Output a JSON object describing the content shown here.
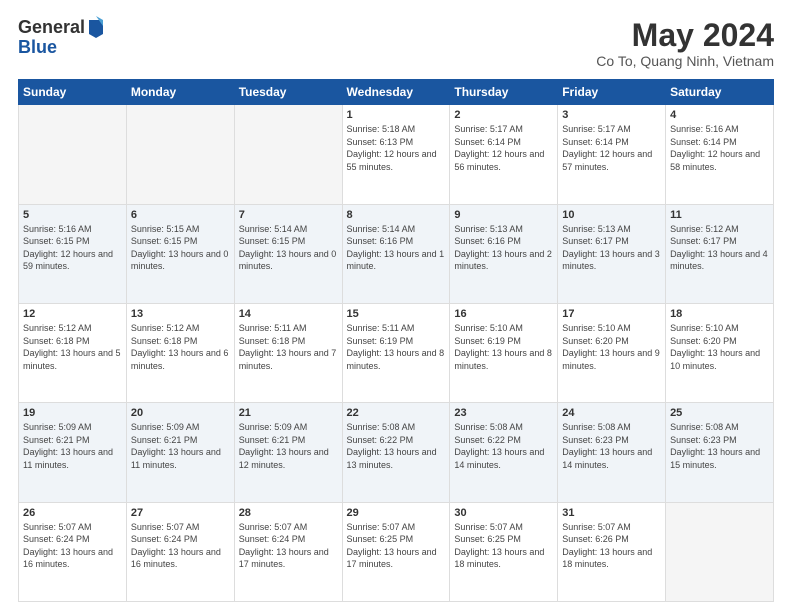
{
  "header": {
    "logo_general": "General",
    "logo_blue": "Blue",
    "month_title": "May 2024",
    "location": "Co To, Quang Ninh, Vietnam"
  },
  "days_of_week": [
    "Sunday",
    "Monday",
    "Tuesday",
    "Wednesday",
    "Thursday",
    "Friday",
    "Saturday"
  ],
  "weeks": [
    {
      "days": [
        {
          "num": "",
          "sunrise": "",
          "sunset": "",
          "daylight": ""
        },
        {
          "num": "",
          "sunrise": "",
          "sunset": "",
          "daylight": ""
        },
        {
          "num": "",
          "sunrise": "",
          "sunset": "",
          "daylight": ""
        },
        {
          "num": "1",
          "sunrise": "Sunrise: 5:18 AM",
          "sunset": "Sunset: 6:13 PM",
          "daylight": "Daylight: 12 hours and 55 minutes."
        },
        {
          "num": "2",
          "sunrise": "Sunrise: 5:17 AM",
          "sunset": "Sunset: 6:14 PM",
          "daylight": "Daylight: 12 hours and 56 minutes."
        },
        {
          "num": "3",
          "sunrise": "Sunrise: 5:17 AM",
          "sunset": "Sunset: 6:14 PM",
          "daylight": "Daylight: 12 hours and 57 minutes."
        },
        {
          "num": "4",
          "sunrise": "Sunrise: 5:16 AM",
          "sunset": "Sunset: 6:14 PM",
          "daylight": "Daylight: 12 hours and 58 minutes."
        }
      ]
    },
    {
      "days": [
        {
          "num": "5",
          "sunrise": "Sunrise: 5:16 AM",
          "sunset": "Sunset: 6:15 PM",
          "daylight": "Daylight: 12 hours and 59 minutes."
        },
        {
          "num": "6",
          "sunrise": "Sunrise: 5:15 AM",
          "sunset": "Sunset: 6:15 PM",
          "daylight": "Daylight: 13 hours and 0 minutes."
        },
        {
          "num": "7",
          "sunrise": "Sunrise: 5:14 AM",
          "sunset": "Sunset: 6:15 PM",
          "daylight": "Daylight: 13 hours and 0 minutes."
        },
        {
          "num": "8",
          "sunrise": "Sunrise: 5:14 AM",
          "sunset": "Sunset: 6:16 PM",
          "daylight": "Daylight: 13 hours and 1 minute."
        },
        {
          "num": "9",
          "sunrise": "Sunrise: 5:13 AM",
          "sunset": "Sunset: 6:16 PM",
          "daylight": "Daylight: 13 hours and 2 minutes."
        },
        {
          "num": "10",
          "sunrise": "Sunrise: 5:13 AM",
          "sunset": "Sunset: 6:17 PM",
          "daylight": "Daylight: 13 hours and 3 minutes."
        },
        {
          "num": "11",
          "sunrise": "Sunrise: 5:12 AM",
          "sunset": "Sunset: 6:17 PM",
          "daylight": "Daylight: 13 hours and 4 minutes."
        }
      ]
    },
    {
      "days": [
        {
          "num": "12",
          "sunrise": "Sunrise: 5:12 AM",
          "sunset": "Sunset: 6:18 PM",
          "daylight": "Daylight: 13 hours and 5 minutes."
        },
        {
          "num": "13",
          "sunrise": "Sunrise: 5:12 AM",
          "sunset": "Sunset: 6:18 PM",
          "daylight": "Daylight: 13 hours and 6 minutes."
        },
        {
          "num": "14",
          "sunrise": "Sunrise: 5:11 AM",
          "sunset": "Sunset: 6:18 PM",
          "daylight": "Daylight: 13 hours and 7 minutes."
        },
        {
          "num": "15",
          "sunrise": "Sunrise: 5:11 AM",
          "sunset": "Sunset: 6:19 PM",
          "daylight": "Daylight: 13 hours and 8 minutes."
        },
        {
          "num": "16",
          "sunrise": "Sunrise: 5:10 AM",
          "sunset": "Sunset: 6:19 PM",
          "daylight": "Daylight: 13 hours and 8 minutes."
        },
        {
          "num": "17",
          "sunrise": "Sunrise: 5:10 AM",
          "sunset": "Sunset: 6:20 PM",
          "daylight": "Daylight: 13 hours and 9 minutes."
        },
        {
          "num": "18",
          "sunrise": "Sunrise: 5:10 AM",
          "sunset": "Sunset: 6:20 PM",
          "daylight": "Daylight: 13 hours and 10 minutes."
        }
      ]
    },
    {
      "days": [
        {
          "num": "19",
          "sunrise": "Sunrise: 5:09 AM",
          "sunset": "Sunset: 6:21 PM",
          "daylight": "Daylight: 13 hours and 11 minutes."
        },
        {
          "num": "20",
          "sunrise": "Sunrise: 5:09 AM",
          "sunset": "Sunset: 6:21 PM",
          "daylight": "Daylight: 13 hours and 11 minutes."
        },
        {
          "num": "21",
          "sunrise": "Sunrise: 5:09 AM",
          "sunset": "Sunset: 6:21 PM",
          "daylight": "Daylight: 13 hours and 12 minutes."
        },
        {
          "num": "22",
          "sunrise": "Sunrise: 5:08 AM",
          "sunset": "Sunset: 6:22 PM",
          "daylight": "Daylight: 13 hours and 13 minutes."
        },
        {
          "num": "23",
          "sunrise": "Sunrise: 5:08 AM",
          "sunset": "Sunset: 6:22 PM",
          "daylight": "Daylight: 13 hours and 14 minutes."
        },
        {
          "num": "24",
          "sunrise": "Sunrise: 5:08 AM",
          "sunset": "Sunset: 6:23 PM",
          "daylight": "Daylight: 13 hours and 14 minutes."
        },
        {
          "num": "25",
          "sunrise": "Sunrise: 5:08 AM",
          "sunset": "Sunset: 6:23 PM",
          "daylight": "Daylight: 13 hours and 15 minutes."
        }
      ]
    },
    {
      "days": [
        {
          "num": "26",
          "sunrise": "Sunrise: 5:07 AM",
          "sunset": "Sunset: 6:24 PM",
          "daylight": "Daylight: 13 hours and 16 minutes."
        },
        {
          "num": "27",
          "sunrise": "Sunrise: 5:07 AM",
          "sunset": "Sunset: 6:24 PM",
          "daylight": "Daylight: 13 hours and 16 minutes."
        },
        {
          "num": "28",
          "sunrise": "Sunrise: 5:07 AM",
          "sunset": "Sunset: 6:24 PM",
          "daylight": "Daylight: 13 hours and 17 minutes."
        },
        {
          "num": "29",
          "sunrise": "Sunrise: 5:07 AM",
          "sunset": "Sunset: 6:25 PM",
          "daylight": "Daylight: 13 hours and 17 minutes."
        },
        {
          "num": "30",
          "sunrise": "Sunrise: 5:07 AM",
          "sunset": "Sunset: 6:25 PM",
          "daylight": "Daylight: 13 hours and 18 minutes."
        },
        {
          "num": "31",
          "sunrise": "Sunrise: 5:07 AM",
          "sunset": "Sunset: 6:26 PM",
          "daylight": "Daylight: 13 hours and 18 minutes."
        },
        {
          "num": "",
          "sunrise": "",
          "sunset": "",
          "daylight": ""
        }
      ]
    }
  ]
}
